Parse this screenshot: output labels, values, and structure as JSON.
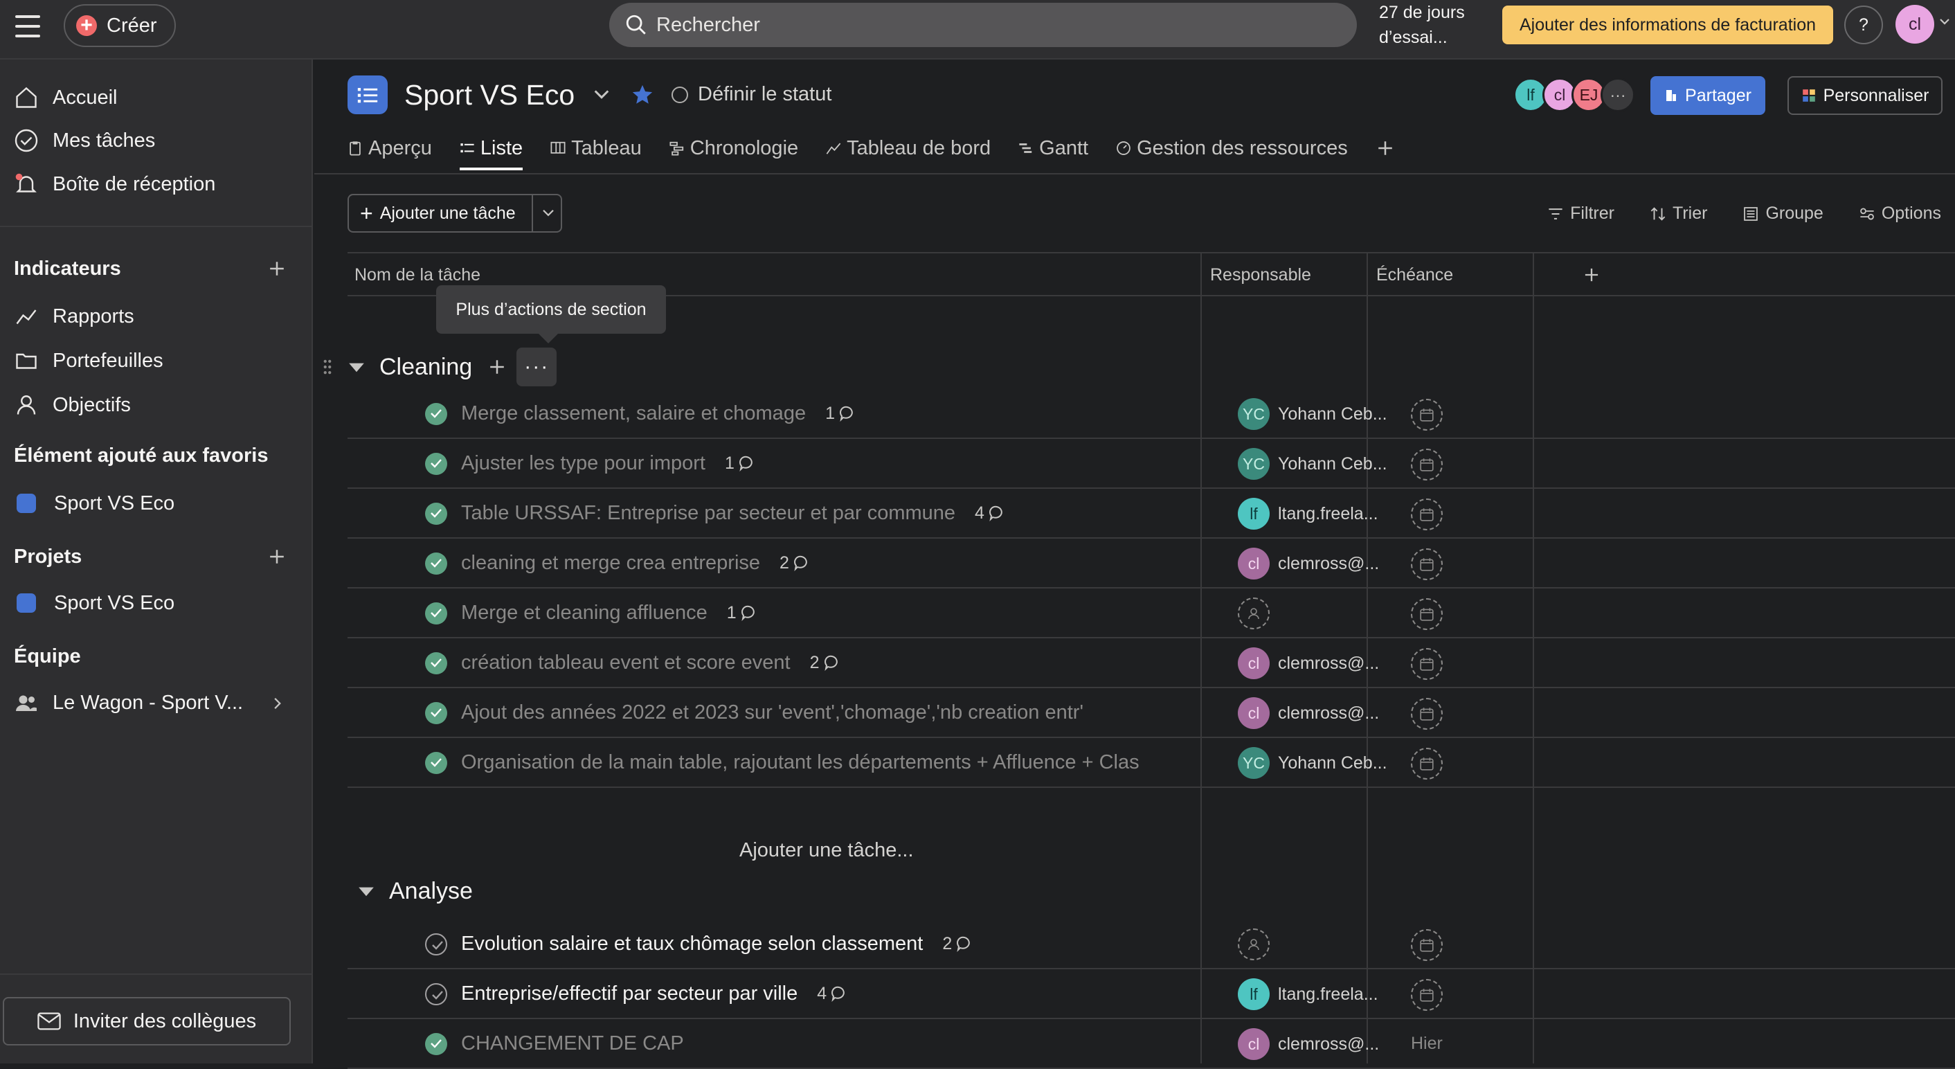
{
  "topbar": {
    "create_label": "Créer",
    "search_placeholder": "Rechercher",
    "trial_text": "27 de jours d’essai...",
    "billing_label": "Ajouter des informations de facturation",
    "help_label": "?",
    "user_initials": "cl"
  },
  "sidebar": {
    "nav": [
      {
        "label": "Accueil",
        "icon": "home-icon"
      },
      {
        "label": "Mes tâches",
        "icon": "check-circle-icon"
      },
      {
        "label": "Boîte de réception",
        "icon": "bell-icon"
      }
    ],
    "indicators_heading": "Indicateurs",
    "indicators": [
      {
        "label": "Rapports",
        "icon": "chart-line-icon"
      },
      {
        "label": "Portefeuilles",
        "icon": "folder-icon"
      },
      {
        "label": "Objectifs",
        "icon": "person-icon"
      }
    ],
    "favorites_heading": "Élément ajouté aux favoris",
    "favorite_item": "Sport VS Eco",
    "projects_heading": "Projets",
    "project_item": "Sport VS Eco",
    "team_heading": "Équipe",
    "team_item": "Le Wagon - Sport V...",
    "invite_label": "Inviter des collègues",
    "project_color": "#4573d2"
  },
  "project": {
    "title": "Sport VS Eco",
    "status_label": "Définir le statut",
    "members": [
      {
        "initials": "lf",
        "color": "#4ec5c1"
      },
      {
        "initials": "cl",
        "color": "#e9a6e2"
      },
      {
        "initials": "EJ",
        "color": "#f07c8a"
      }
    ],
    "share_label": "Partager",
    "customize_label": "Personnaliser",
    "tabs": [
      {
        "label": "Aperçu",
        "active": false
      },
      {
        "label": "Liste",
        "active": true
      },
      {
        "label": "Tableau",
        "active": false
      },
      {
        "label": "Chronologie",
        "active": false
      },
      {
        "label": "Tableau de bord",
        "active": false
      },
      {
        "label": "Gantt",
        "active": false
      },
      {
        "label": "Gestion des ressources",
        "active": false
      }
    ]
  },
  "toolbar": {
    "add_task_label": "Ajouter une tâche",
    "filter_label": "Filtrer",
    "sort_label": "Trier",
    "group_label": "Groupe",
    "options_label": "Options"
  },
  "columns": {
    "name": "Nom de la tâche",
    "assignee": "Responsable",
    "due": "Échéance"
  },
  "tooltip": "Plus d’actions de section",
  "sections": [
    {
      "title": "Cleaning",
      "tasks": [
        {
          "name": "Merge classement, salaire et chomage",
          "comments": "1",
          "done": true,
          "assignee": "Yohann Ceb...",
          "initials": "YC",
          "av": "yc"
        },
        {
          "name": "Ajuster les type pour import",
          "comments": "1",
          "done": true,
          "assignee": "Yohann Ceb...",
          "initials": "YC",
          "av": "yc"
        },
        {
          "name": "Table URSSAF: Entreprise par secteur et par commune",
          "comments": "4",
          "done": true,
          "assignee": "ltang.freela...",
          "initials": "lf",
          "av": "lf"
        },
        {
          "name": "cleaning et merge crea entreprise",
          "comments": "2",
          "done": true,
          "assignee": "clemross@...",
          "initials": "cl",
          "av": "cl"
        },
        {
          "name": "Merge et cleaning affluence",
          "comments": "1",
          "done": true,
          "assignee": "",
          "initials": "",
          "av": "empty"
        },
        {
          "name": "création tableau event et score event",
          "comments": "2",
          "done": true,
          "assignee": "clemross@...",
          "initials": "cl",
          "av": "cl"
        },
        {
          "name": "Ajout des années 2022 et 2023 sur 'event','chomage','nb creation entr'",
          "comments": "",
          "done": true,
          "assignee": "clemross@...",
          "initials": "cl",
          "av": "cl"
        },
        {
          "name": "Organisation de la main table, rajoutant les départements + Affluence + Clas",
          "comments": "",
          "done": true,
          "assignee": "Yohann Ceb...",
          "initials": "YC",
          "av": "yc"
        }
      ],
      "add_subtask": "Ajouter une tâche..."
    },
    {
      "title": "Analyse",
      "tasks": [
        {
          "name": "Evolution salaire et taux chômage selon classement",
          "comments": "2",
          "done": false,
          "assignee": "",
          "initials": "",
          "av": "empty"
        },
        {
          "name": "Entreprise/effectif par secteur par ville",
          "comments": "4",
          "done": false,
          "assignee": "ltang.freela...",
          "initials": "lf",
          "av": "lf"
        },
        {
          "name": "CHANGEMENT DE CAP",
          "comments": "",
          "done": true,
          "assignee": "clemross@...",
          "initials": "cl",
          "av": "cl",
          "due": "Hier"
        }
      ]
    }
  ]
}
